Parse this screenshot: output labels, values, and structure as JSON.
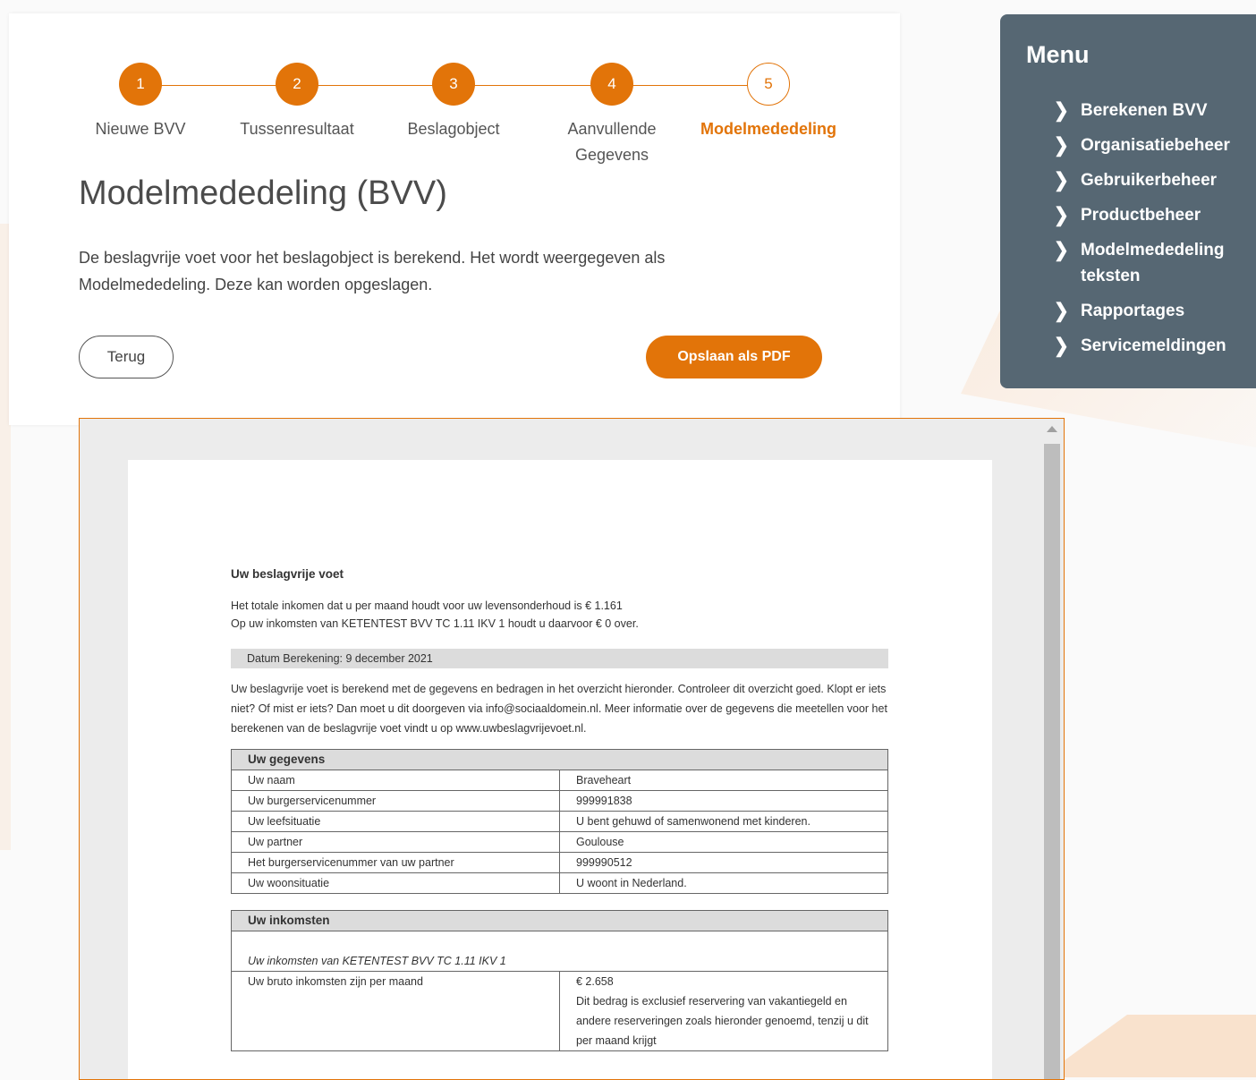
{
  "stepper": {
    "steps": [
      {
        "number": "1",
        "label": "Nieuwe BVV"
      },
      {
        "number": "2",
        "label": "Tussenresultaat"
      },
      {
        "number": "3",
        "label": "Beslagobject"
      },
      {
        "number": "4",
        "label": "Aanvullende Gegevens"
      },
      {
        "number": "5",
        "label": "Modelmededeling"
      }
    ],
    "active_step": 5
  },
  "page": {
    "title": "Modelmededeling (BVV)",
    "intro": "De beslagvrije voet voor het beslagobject is berekend. Het wordt weergegeven als Modelmededeling. Deze kan worden opgeslagen."
  },
  "actions": {
    "back_label": "Terug",
    "save_pdf_label": "Opslaan als PDF"
  },
  "menu": {
    "title": "Menu",
    "items": [
      "Berekenen BVV",
      "Organisatiebeheer",
      "Gebruikerbeheer",
      "Productbeheer",
      "Modelmededeling teksten",
      "Rapportages",
      "Servicemeldingen"
    ]
  },
  "document": {
    "heading": "Uw beslagvrije voet",
    "line1": "Het totale inkomen dat u per maand houdt voor uw levensonderhoud is € 1.161",
    "line2": "Op uw inkomsten van KETENTEST BVV TC 1.11 IKV 1 houdt u daarvoor € 0 over.",
    "date_label": "Datum Berekening: 9 december 2021",
    "explanation": "Uw beslagvrije voet is berekend met de gegevens en bedragen in het overzicht hieronder. Controleer dit overzicht goed. Klopt er iets niet? Of mist er iets? Dan moet u dit doorgeven via info@sociaaldomein.nl. Meer informatie over de gegevens die meetellen voor het berekenen van de beslagvrije voet vindt u op www.uwbeslagvrijevoet.nl.",
    "gegevens": {
      "header": "Uw gegevens",
      "rows": [
        [
          "Uw naam",
          "Braveheart"
        ],
        [
          "Uw burgerservicenummer",
          "999991838"
        ],
        [
          "Uw leefsituatie",
          "U bent gehuwd of samenwonend met kinderen."
        ],
        [
          "Uw partner",
          "Goulouse"
        ],
        [
          "Het burgerservicenummer van uw partner",
          "999990512"
        ],
        [
          "Uw woonsituatie",
          "U woont in Nederland."
        ]
      ]
    },
    "inkomsten": {
      "header": "Uw inkomsten",
      "subheader": "Uw inkomsten van KETENTEST BVV TC 1.11 IKV 1",
      "bruto_label": "Uw bruto inkomsten zijn per maand",
      "bruto_value": "€ 2.658",
      "bruto_note": "Dit bedrag is exclusief reservering van vakantiegeld en andere reserveringen zoals hieronder genoemd, tenzij u dit per maand krijgt"
    }
  },
  "colors": {
    "accent": "#e27409",
    "menu_bg": "#566773"
  }
}
